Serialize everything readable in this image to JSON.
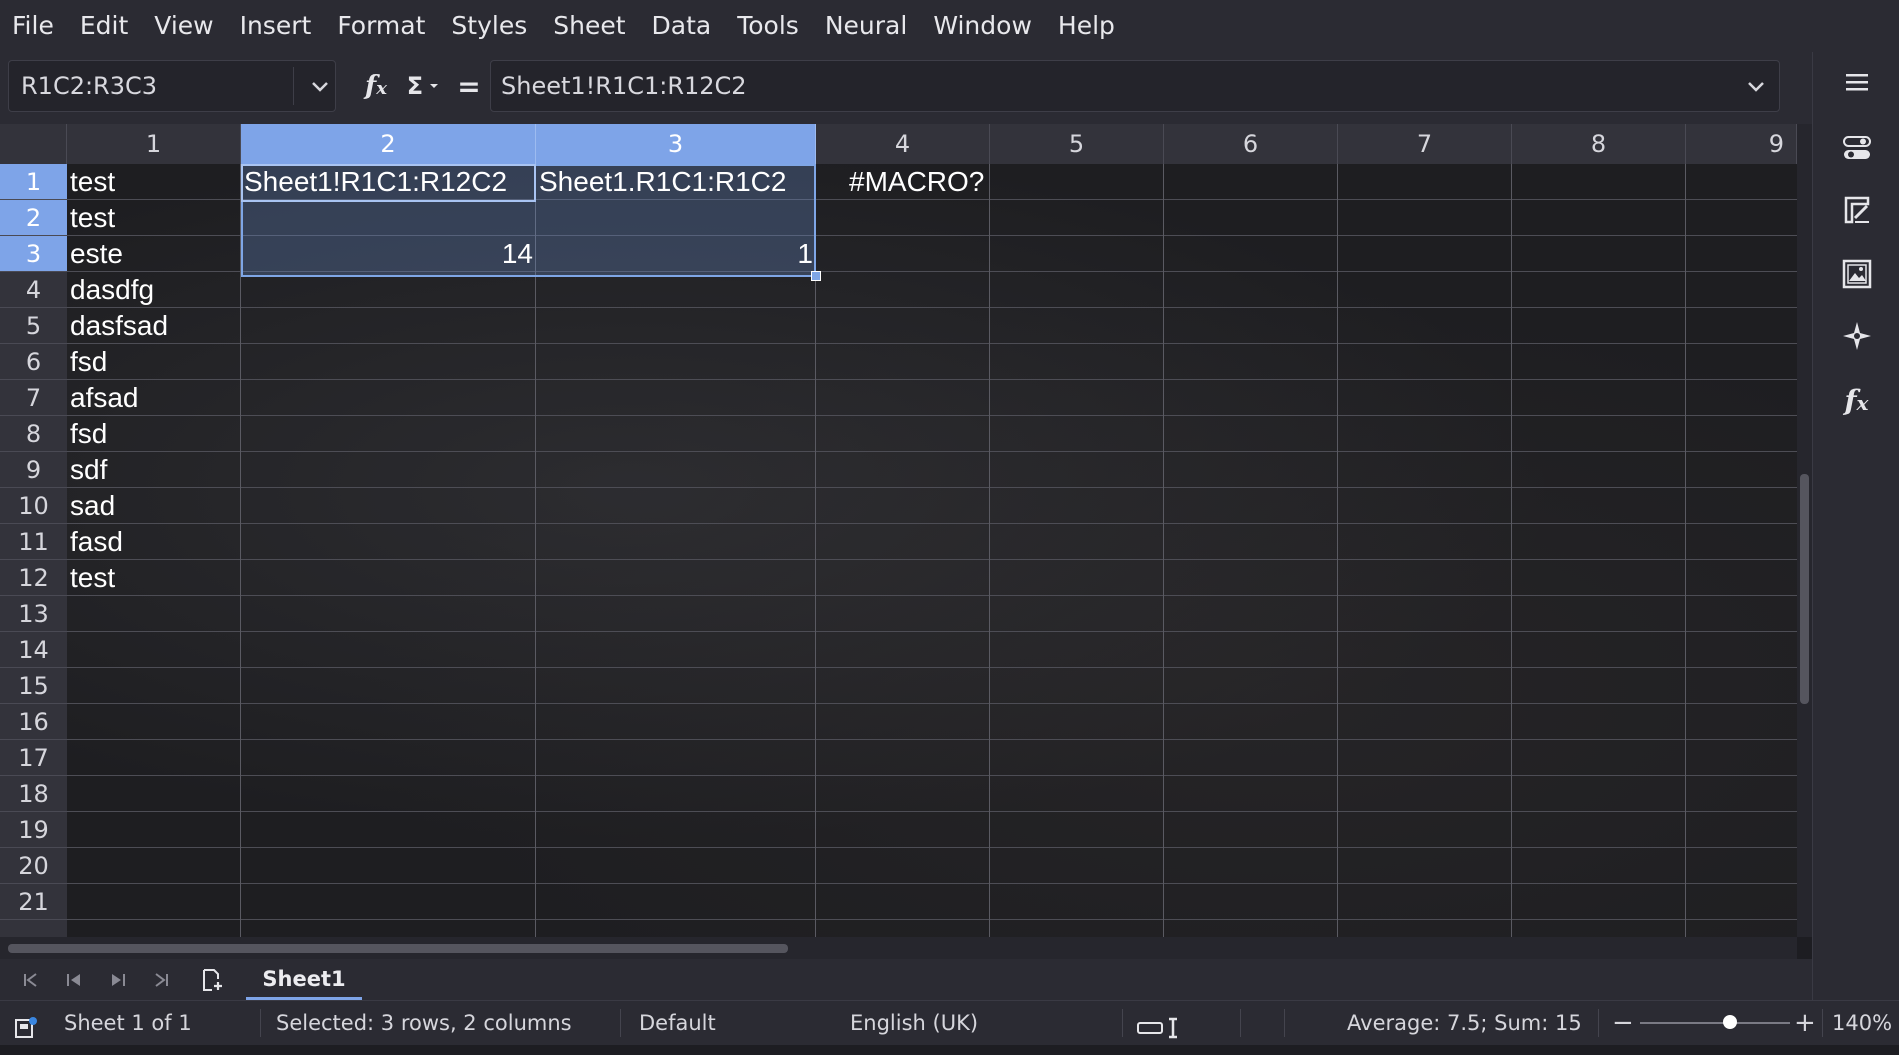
{
  "menu": [
    "File",
    "Edit",
    "View",
    "Insert",
    "Format",
    "Styles",
    "Sheet",
    "Data",
    "Tools",
    "Neural",
    "Window",
    "Help"
  ],
  "formula_bar": {
    "name_box": "R1C2:R3C3",
    "formula": "Sheet1!R1C1:R12C2",
    "fx_icon": "function-wizard-icon",
    "sum_icon": "sum-icon",
    "equals_icon": "formula-icon"
  },
  "columns": [
    "1",
    "2",
    "3",
    "4",
    "5",
    "6",
    "7",
    "8",
    "9"
  ],
  "rows": [
    "1",
    "2",
    "3",
    "4",
    "5",
    "6",
    "7",
    "8",
    "9",
    "10",
    "11",
    "12",
    "13",
    "14",
    "15",
    "16",
    "17",
    "18",
    "19",
    "20",
    "21"
  ],
  "cells": {
    "a1": "test",
    "a2": "test",
    "a3": "este",
    "a4": "dasdfg",
    "a5": "dasfsad",
    "a6": "fsd",
    "a7": "afsad",
    "a8": "fsd",
    "a9": "sdf",
    "a10": "sad",
    "a11": "fasd",
    "a12": "test",
    "b1": "Sheet1!R1C1:R12C2",
    "c1": "Sheet1.R1C1:R1C2",
    "d1": "#MACRO?",
    "b3": "14",
    "c3": "1"
  },
  "sidebar_icons": [
    "hamburger-menu-icon",
    "properties-icon",
    "styles-icon",
    "gallery-icon",
    "navigator-icon",
    "functions-icon"
  ],
  "sheet_tab": "Sheet1",
  "status": {
    "sheet": "Sheet 1 of 1",
    "selection": "Selected: 3 rows, 2 columns",
    "page_style": "Default",
    "language": "English (UK)",
    "summary": "Average: 7.5; Sum: 15",
    "zoom": "140%",
    "zoom_level_fraction": 0.6
  },
  "colors": {
    "accent": "#7ea4e8",
    "background": "#1e1e21",
    "chrome": "#2b2b33"
  }
}
